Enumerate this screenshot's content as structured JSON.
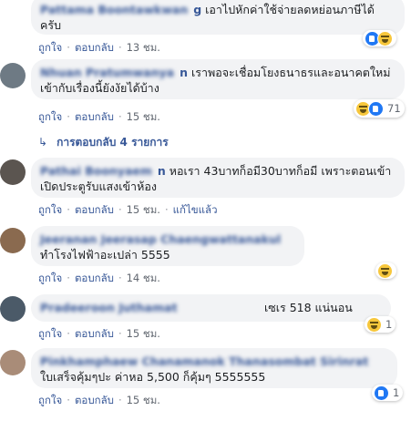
{
  "actions": {
    "like": "ถูกใจ",
    "reply": "ตอบกลับ",
    "separator": "·",
    "edited": "แก้ไขแล้ว"
  },
  "comments": [
    {
      "name": "Pattama Boontawkwan",
      "name_tail": "g",
      "text": "เอาไปหักค่าใช้จ่ายลดหย่อนภาษีได้ครับ",
      "time": "13 ชม.",
      "reaction_count": "",
      "avatar_color": "#c9b7a3"
    },
    {
      "name": "Nhuan Pratumwanya",
      "name_tail": "n",
      "text": "เราพอจะเชื่อมโยงธนาธรและอนาคตใหม่เข้ากับเรื่องนี้ยังงัยได้บ้าง",
      "time": "15 ชม.",
      "reaction_count": "71",
      "avatar_color": "#6e7a84"
    },
    {
      "name": "Pathai Boonyaem",
      "name_tail": "n",
      "text": "หอเรา 43บาทก็อมี30บาทก็อมี เพราะตอนเข้าเปิดประตูรับแสงเข้าห้อง",
      "time": "15 ชม.",
      "reaction_count": "",
      "avatar_color": "#5b5550"
    },
    {
      "name": "Jeeranan Jeerasap Chaengwattanakul",
      "name_tail": "",
      "text": "ทำโรงไฟฟ้าอะเปล่า 5555",
      "time": "14 ชม.",
      "reaction_count": "",
      "avatar_color": "#8a6a4f"
    },
    {
      "name": "Pradeeroon Juthamat",
      "name_tail": "",
      "text": "เซเร 518 แน่นอน",
      "time": "15 ชม.",
      "reaction_count": "1",
      "avatar_color": "#4b5a68"
    },
    {
      "name": "Pinkhamphaew Chanamanok Thanasombat Sirinrat",
      "name_tail": "",
      "text": "ใบเสร็จคุ้มๆปะ ค่าหอ 5,500 ก็คุ้มๆ 5555555",
      "time": "15 ชม.",
      "reaction_count": "1",
      "avatar_color": "#a98c78"
    }
  ],
  "replies_link": "การตอบกลับ 4 รายการ"
}
